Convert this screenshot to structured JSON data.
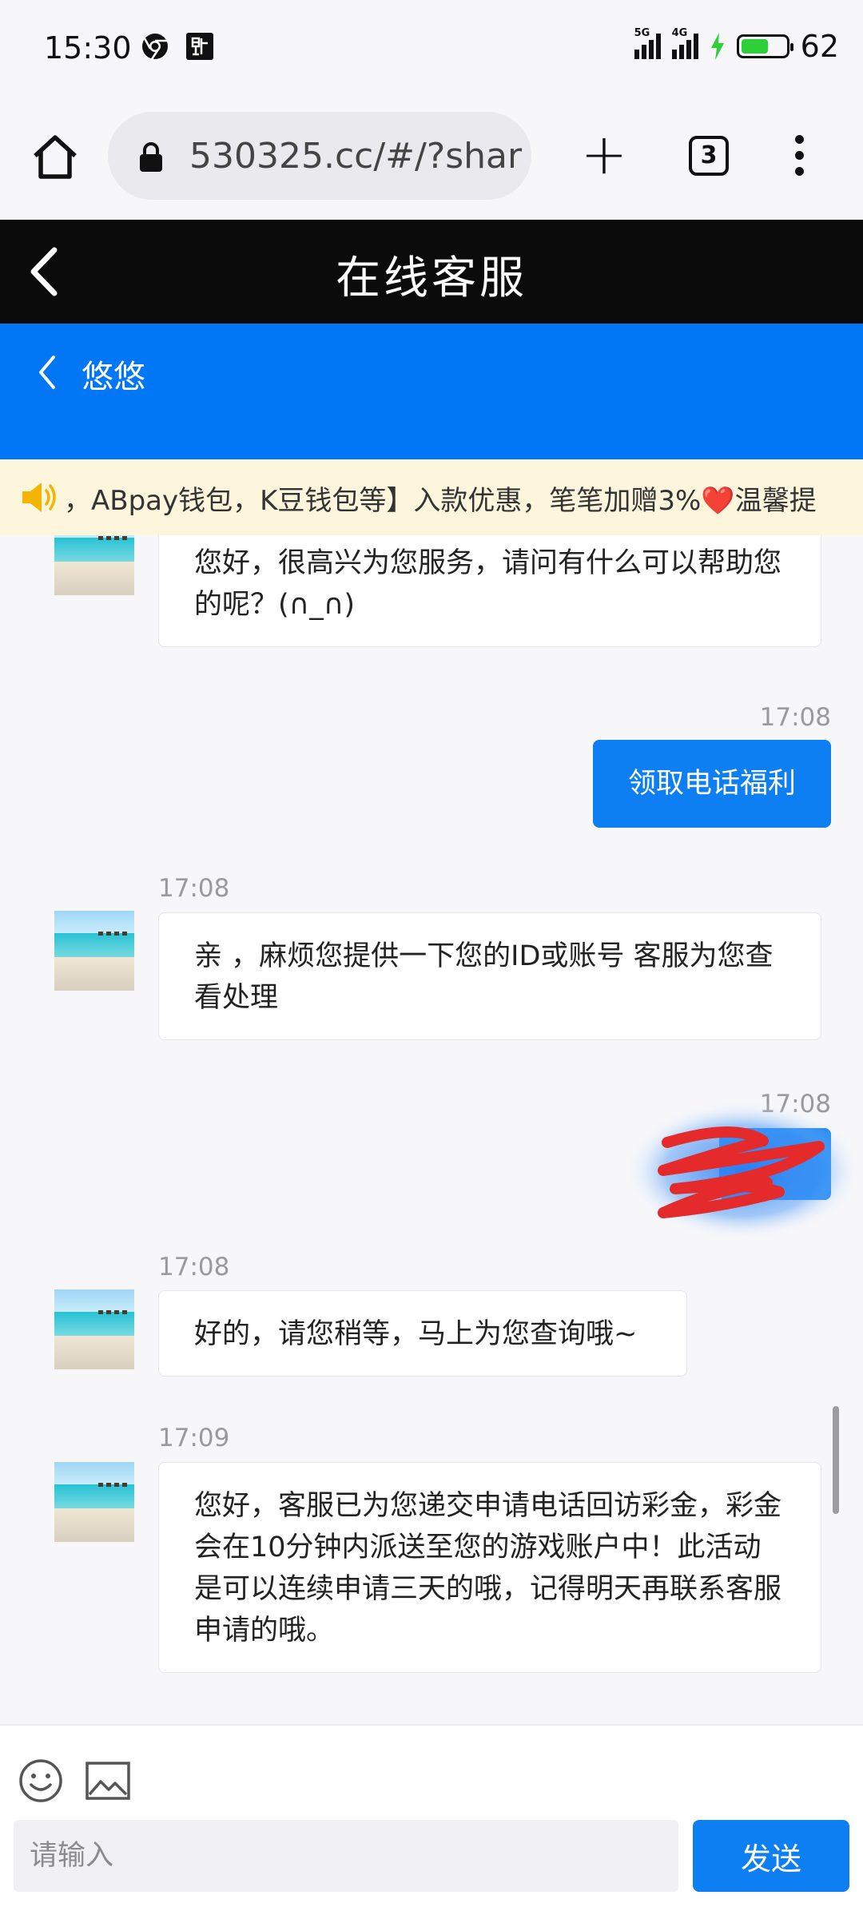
{
  "status_bar": {
    "time": "15:30",
    "battery": "62",
    "battery_level": 0.62,
    "signal_1": "5G",
    "signal_2": "4G",
    "icons": [
      "chrome-icon",
      "tieba-icon",
      "signal-icon",
      "charging-icon",
      "battery-icon"
    ]
  },
  "browser": {
    "url": "530325.cc/#/?shar",
    "tab_count": "3"
  },
  "header": {
    "title": "在线客服",
    "agent_name": "悠悠"
  },
  "notice": {
    "text": "，ABpay钱包，K豆钱包等】入款优惠，笔笔加赠3%",
    "heart": "❤️",
    "text_tail": "温馨提"
  },
  "messages": [
    {
      "side": "in",
      "time": "",
      "text": "您好，很高兴为您服务，请问有什么可以帮助您的呢？(∩_∩)"
    },
    {
      "side": "out",
      "time": "17:08",
      "text": "领取电话福利"
    },
    {
      "side": "in",
      "time": "17:08",
      "text": "亲 ，麻烦您提供一下您的ID或账号 客服为您查看处理"
    },
    {
      "side": "out",
      "time": "17:08",
      "text": ""
    },
    {
      "side": "in",
      "time": "17:08",
      "text": "好的，请您稍等，马上为您查询哦~"
    },
    {
      "side": "in",
      "time": "17:09",
      "text": "您好，客服已为您递交申请电话回访彩金，彩金会在10分钟内派送至您的游戏账户中！此活动是可以连续申请三天的哦，记得明天再联系客服申请的哦。"
    }
  ],
  "composer": {
    "placeholder": "请输入",
    "send_label": "发送"
  },
  "colors": {
    "header_bg": "#0b0b0b",
    "agent_bar": "#0277f5",
    "bubble_out": "#0e7ff2",
    "notice_bg": "#fdf6dd"
  }
}
